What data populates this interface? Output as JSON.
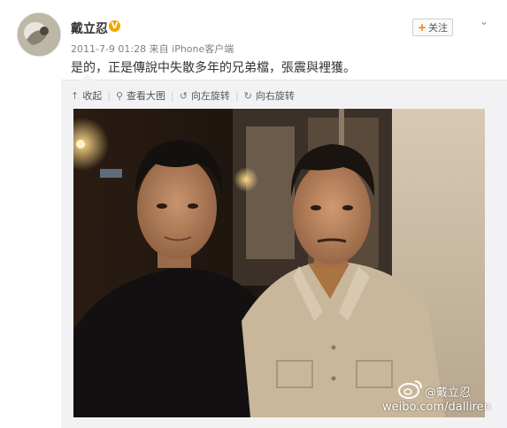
{
  "post": {
    "username": "戴立忍",
    "verified_badge": "V",
    "timestamp": "2011-7-9 01:28",
    "source_prefix": "来自",
    "source": "iPhone客户端",
    "text": "是的，正是傳說中失散多年的兄弟檔，張震與裡獲。",
    "follow_label": "关注",
    "follow_icon": "plus-icon",
    "menu_icon": "chevron-down-icon"
  },
  "toolbar": {
    "collapse_label": "收起",
    "view_large_label": "查看大图",
    "rotate_left_label": "向左旋转",
    "rotate_right_label": "向右旋转"
  },
  "watermark": {
    "handle": "@戴立忍",
    "url": "weibo.com/dalliren",
    "logo_icon": "weibo-logo"
  },
  "colors": {
    "accent": "#f57e00",
    "badge": "#f0a800",
    "panel": "#f2f2f5"
  }
}
